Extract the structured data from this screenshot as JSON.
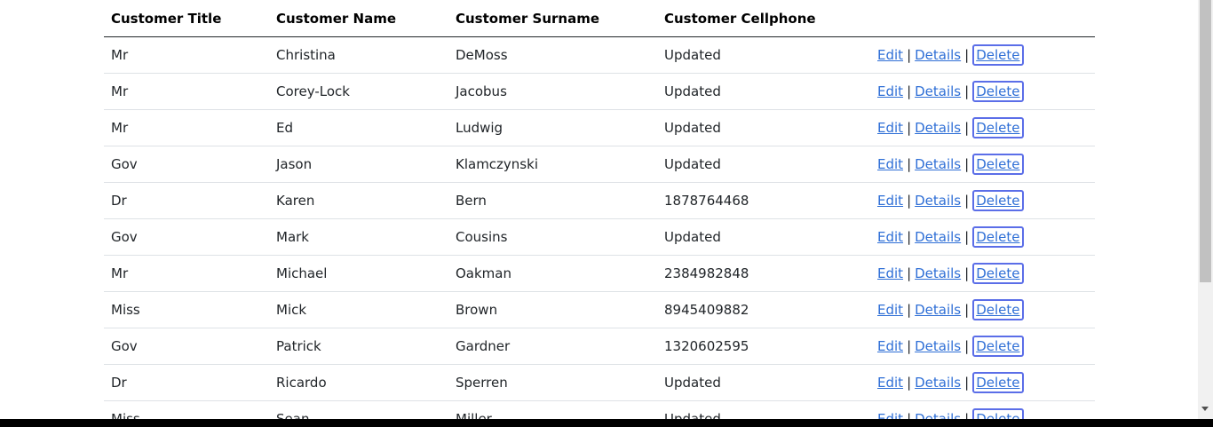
{
  "table": {
    "headers": [
      "Customer Title",
      "Customer Name",
      "Customer Surname",
      "Customer Cellphone"
    ],
    "rows": [
      {
        "title": "Mr",
        "name": "Christina",
        "surname": "DeMoss",
        "cellphone": "Updated"
      },
      {
        "title": "Mr",
        "name": "Corey-Lock",
        "surname": "Jacobus",
        "cellphone": "Updated"
      },
      {
        "title": "Mr",
        "name": "Ed",
        "surname": "Ludwig",
        "cellphone": "Updated"
      },
      {
        "title": "Gov",
        "name": "Jason",
        "surname": "Klamczynski",
        "cellphone": "Updated"
      },
      {
        "title": "Dr",
        "name": "Karen",
        "surname": "Bern",
        "cellphone": "1878764468"
      },
      {
        "title": "Gov",
        "name": "Mark",
        "surname": "Cousins",
        "cellphone": "Updated"
      },
      {
        "title": "Mr",
        "name": "Michael",
        "surname": "Oakman",
        "cellphone": "2384982848"
      },
      {
        "title": "Miss",
        "name": "Mick",
        "surname": "Brown",
        "cellphone": "8945409882"
      },
      {
        "title": "Gov",
        "name": "Patrick",
        "surname": "Gardner",
        "cellphone": "1320602595"
      },
      {
        "title": "Dr",
        "name": "Ricardo",
        "surname": "Sperren",
        "cellphone": "Updated"
      },
      {
        "title": "Miss",
        "name": "Sean",
        "surname": "Miller",
        "cellphone": "Updated"
      }
    ]
  },
  "actions": {
    "edit": "Edit",
    "details": "Details",
    "delete": "Delete",
    "separator": "|"
  },
  "colors": {
    "link": "#2f6fd6",
    "focus_outline": "#5b6ee8",
    "header_rule": "#212529",
    "row_rule": "#dee2e6"
  }
}
